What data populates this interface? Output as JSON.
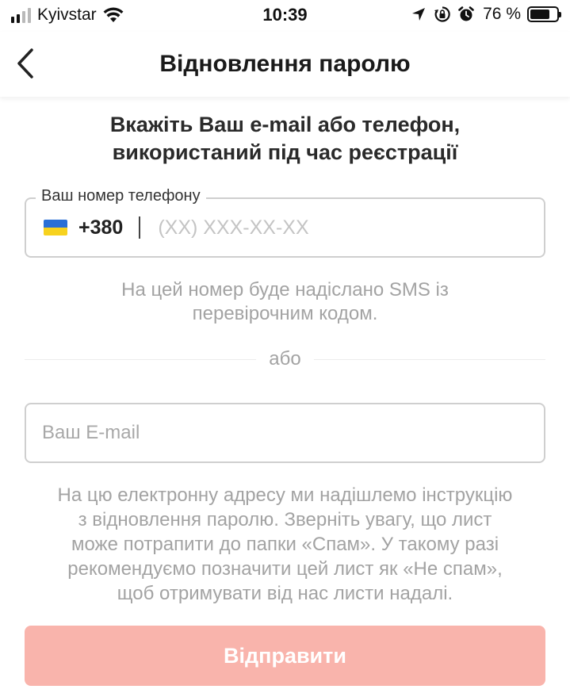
{
  "status_bar": {
    "carrier": "Kyivstar",
    "time": "10:39",
    "battery_percent": "76 %",
    "battery_level": 0.76,
    "icons": [
      "signal-icon",
      "wifi-icon",
      "location-arrow-icon",
      "orientation-lock-icon",
      "alarm-icon",
      "battery-icon"
    ]
  },
  "nav": {
    "title": "Відновлення паролю",
    "back_icon": "chevron-left-icon"
  },
  "heading": {
    "line1": "Вкажіть Ваш e-mail або телефон,",
    "line2": "використаний під час реєстрації"
  },
  "phone": {
    "label": "Ваш номер телефону",
    "flag_icon": "ukraine-flag-icon",
    "country_code": "+380",
    "placeholder": "(XX) XXX-XX-XX",
    "value": ""
  },
  "sms_note": {
    "line1": "На цей номер буде надіслано SMS із",
    "line2": "перевірочним кодом."
  },
  "separator": {
    "text": "або"
  },
  "email": {
    "placeholder": "Ваш E-mail",
    "value": ""
  },
  "email_note": {
    "lines": [
      "На цю електронну адресу ми надішлемо інструкцію",
      "з відновлення паролю. Зверніть увагу, що лист",
      "може потрапити до папки «Спам». У такому разі",
      "рекомендуємо позначити цей лист як «Не спам»,",
      "щоб отримувати від нас листи надалі."
    ]
  },
  "submit": {
    "label": "Відправити",
    "enabled": false
  },
  "colors": {
    "accent_disabled": "#f9b4ac",
    "muted_text": "#a3a3a3",
    "border": "#cfcfcf",
    "flag_blue": "#2a6fd6",
    "flag_yellow": "#f7d21e"
  }
}
